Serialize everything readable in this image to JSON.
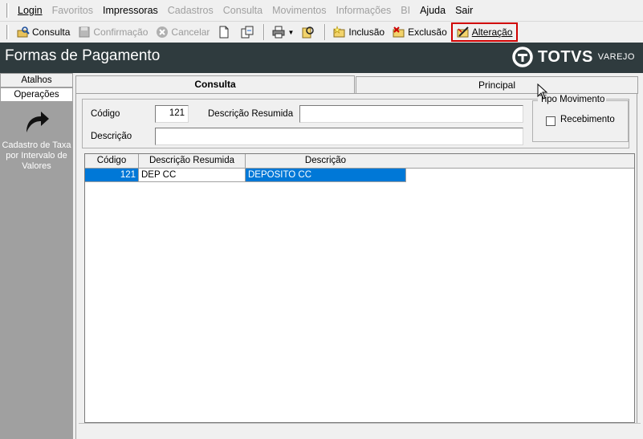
{
  "menu": {
    "items": [
      {
        "label": "Login",
        "disabled": false
      },
      {
        "label": "Favoritos",
        "disabled": true
      },
      {
        "label": "Impressoras",
        "disabled": false
      },
      {
        "label": "Cadastros",
        "disabled": true
      },
      {
        "label": "Consulta",
        "disabled": true
      },
      {
        "label": "Movimentos",
        "disabled": true
      },
      {
        "label": "Informações",
        "disabled": true
      },
      {
        "label": "BI",
        "disabled": true
      },
      {
        "label": "Ajuda",
        "disabled": false
      },
      {
        "label": "Sair",
        "disabled": false
      }
    ]
  },
  "toolbar": {
    "consulta": "Consulta",
    "confirmacao": "Confirmação",
    "cancelar": "Cancelar",
    "inclusao": "Inclusão",
    "exclusao": "Exclusão",
    "alteracao": "Alteração"
  },
  "banner": {
    "title": "Formas de Pagamento",
    "brand": "TOTVS",
    "brand_sub": "VAREJO"
  },
  "sidebar": {
    "tabs": [
      "Atalhos",
      "Operações"
    ],
    "shortcut_label": "Cadastro de Taxa por Intervalo de Valores"
  },
  "tabs": {
    "consulta": "Consulta",
    "principal": "Principal"
  },
  "form": {
    "codigo_label": "Código",
    "codigo_value": "121",
    "descricao_resumida_label": "Descrição Resumida",
    "descricao_resumida_value": "",
    "descricao_label": "Descrição",
    "descricao_value": "",
    "tipo_movimento_label": "Tipo Movimento",
    "recebimento_label": "Recebimento",
    "recebimento_checked": false
  },
  "grid": {
    "columns": [
      "Código",
      "Descrição Resumida",
      "Descrição"
    ],
    "rows": [
      [
        "121",
        "DEP CC",
        "DEPOSITO CC"
      ]
    ]
  },
  "colors": {
    "banner_bg": "#2f3b3e",
    "selection": "#0078d7",
    "highlight_border": "#d00000"
  }
}
